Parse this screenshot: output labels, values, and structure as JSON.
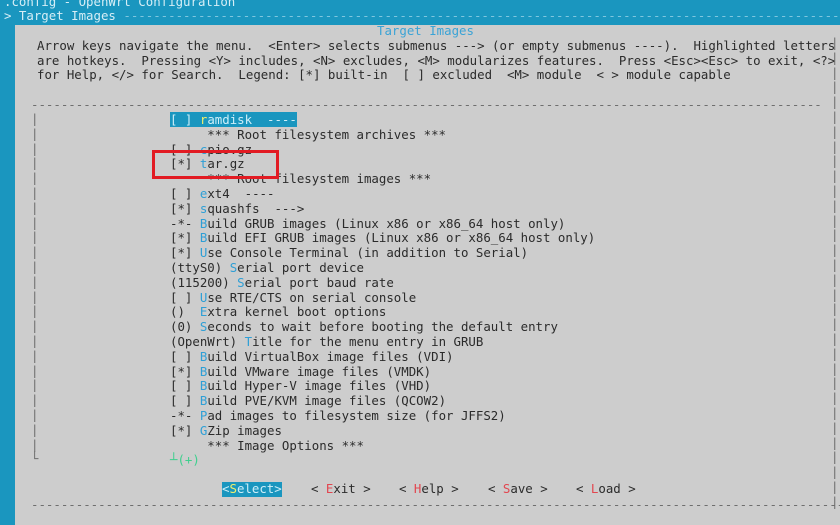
{
  "window": {
    "title": ".config - OpenWrt Configuration",
    "breadcrumb": "> Target Images",
    "breadcrumb_rule": " --------------------------------------------------------------------------------------------------"
  },
  "dialog": {
    "title": "Target Images",
    "help_lines": [
      "Arrow keys navigate the menu.  <Enter> selects submenus ---> (or empty submenus ----).  Highlighted letters",
      "are hotkeys.  Pressing <Y> includes, <N> excludes, <M> modularizes features.  Press <Esc><Esc> to exit, <?>",
      "for Help, </> for Search.  Legend: [*] built-in  [ ] excluded  <M> module  < > module capable"
    ],
    "more_indicator": "(+)",
    "more_prefix": "┴"
  },
  "menu": {
    "items": [
      {
        "prefix": "[ ]",
        "hotkey": "r",
        "rest": "amdisk  ----",
        "selected": true
      },
      {
        "prefix": "   ",
        "hotkey": "",
        "rest": " *** Root filesystem archives ***",
        "selected": false
      },
      {
        "prefix": "[ ]",
        "hotkey": "c",
        "rest": "pio.gz",
        "selected": false
      },
      {
        "prefix": "[*]",
        "hotkey": "t",
        "rest": "ar.gz",
        "selected": false
      },
      {
        "prefix": "   ",
        "hotkey": "",
        "rest": " *** Root filesystem images ***",
        "selected": false
      },
      {
        "prefix": "[ ]",
        "hotkey": "e",
        "rest": "xt4  ----",
        "selected": false
      },
      {
        "prefix": "[*]",
        "hotkey": "s",
        "rest": "quashfs  --->",
        "selected": false
      },
      {
        "prefix": "-*-",
        "hotkey": "B",
        "rest": "uild GRUB images (Linux x86 or x86_64 host only)",
        "selected": false
      },
      {
        "prefix": "[*]",
        "hotkey": "B",
        "rest": "uild EFI GRUB images (Linux x86 or x86_64 host only)",
        "selected": false
      },
      {
        "prefix": "[*]",
        "hotkey": "U",
        "rest": "se Console Terminal (in addition to Serial)",
        "selected": false
      },
      {
        "prefix": "(ttyS0)",
        "hotkey": "S",
        "rest": "erial port device",
        "selected": false
      },
      {
        "prefix": "(115200)",
        "hotkey": "S",
        "rest": "erial port baud rate",
        "selected": false
      },
      {
        "prefix": "[ ]",
        "hotkey": "U",
        "rest": "se RTE/CTS on serial console",
        "selected": false
      },
      {
        "prefix": "() ",
        "hotkey": "E",
        "rest": "xtra kernel boot options",
        "selected": false
      },
      {
        "prefix": "(0)",
        "hotkey": "S",
        "rest": "econds to wait before booting the default entry",
        "selected": false
      },
      {
        "prefix": "(OpenWrt)",
        "hotkey": "T",
        "rest": "itle for the menu entry in GRUB",
        "selected": false
      },
      {
        "prefix": "[ ]",
        "hotkey": "B",
        "rest": "uild VirtualBox image files (VDI)",
        "selected": false
      },
      {
        "prefix": "[*]",
        "hotkey": "B",
        "rest": "uild VMware image files (VMDK)",
        "selected": false
      },
      {
        "prefix": "[ ]",
        "hotkey": "B",
        "rest": "uild Hyper-V image files (VHD)",
        "selected": false
      },
      {
        "prefix": "[ ]",
        "hotkey": "B",
        "rest": "uild PVE/KVM image files (QCOW2)",
        "selected": false
      },
      {
        "prefix": "-*-",
        "hotkey": "P",
        "rest": "ad images to filesystem size (for JFFS2)",
        "selected": false
      },
      {
        "prefix": "[*]",
        "hotkey": "G",
        "rest": "Zip images",
        "selected": false
      },
      {
        "prefix": "   ",
        "hotkey": "",
        "rest": " *** Image Options ***",
        "selected": false
      }
    ]
  },
  "buttons": [
    {
      "open": "<",
      "hotkey": "S",
      "rest": "elect",
      "close": ">",
      "active": true
    },
    {
      "open": "< ",
      "hotkey": "E",
      "rest": "xit",
      "close": " >",
      "active": false
    },
    {
      "open": "< ",
      "hotkey": "H",
      "rest": "elp",
      "close": " >",
      "active": false
    },
    {
      "open": "< ",
      "hotkey": "S",
      "rest": "ave",
      "close": " >",
      "active": false
    },
    {
      "open": "< ",
      "hotkey": "L",
      "rest": "oad",
      "close": " >",
      "active": false
    }
  ],
  "annotation": {
    "target": "tar.gz",
    "color": "#e21b23"
  },
  "colors": {
    "background": "#1a96bf",
    "panel": "#cdcdcd",
    "hotkey": "#2e9fd6",
    "button_hotkey": "#e2464f",
    "selected_hotkey": "#f2f06a"
  }
}
